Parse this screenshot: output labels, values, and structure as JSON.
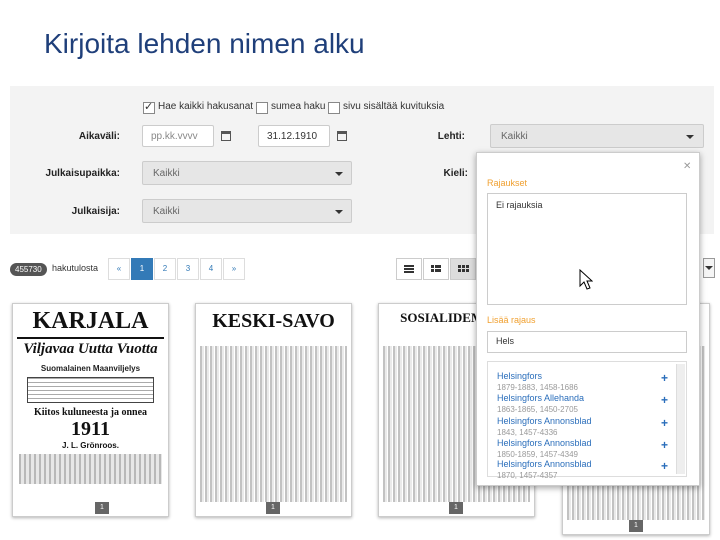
{
  "slide": {
    "title": "Kirjoita lehden nimen alku"
  },
  "filters": {
    "checkboxes": [
      {
        "label": "Hae kaikki hakusanat",
        "checked": true
      },
      {
        "label": "sumea haku",
        "checked": false
      },
      {
        "label": "sivu sisältää kuvituksia",
        "checked": false
      }
    ],
    "date_label": "Aikaväli:",
    "date_from_placeholder": "pp.kk.vvvv",
    "date_to_value": "31.12.1910",
    "lehti_label": "Lehti:",
    "lehti_value": "Kaikki",
    "julkaisupaikka_label": "Julkaisupaikka:",
    "julkaisupaikka_value": "Kaikki",
    "kieli_label": "Kieli:",
    "julkaisija_label": "Julkaisija:",
    "julkaisija_value": "Kaikki"
  },
  "results": {
    "count_badge": "455730",
    "count_label": "hakutulosta",
    "pages": [
      "«",
      "1",
      "2",
      "3",
      "4",
      "»"
    ],
    "active_page": "1"
  },
  "popup": {
    "rajaukset_title": "Rajaukset",
    "rajaukset_value": "Ei rajauksia",
    "lisaa_title": "Lisää rajaus",
    "search_value": "Hels",
    "items": [
      {
        "name": "Helsingfors",
        "years": "1879-1883, 1458-1686"
      },
      {
        "name": "Helsingfors Allehanda",
        "years": "1863-1865, 1450-2705"
      },
      {
        "name": "Helsingfors Annonsblad",
        "years": "1843, 1457-4336"
      },
      {
        "name": "Helsingfors Annonsblad",
        "years": "1850-1859, 1457-4349"
      },
      {
        "name": "Helsingfors Annonsblad",
        "years": "1870, 1457-4357"
      }
    ]
  },
  "thumbnails": [
    {
      "masthead": "KARJALA",
      "lines": [
        "Viljavaa Uutta Vuotta",
        "Suomalainen Maanviljelys",
        "Kiitos kuluneesta ja onnea",
        "1911",
        "J. L. Grönroos."
      ],
      "num": "1"
    },
    {
      "masthead": "KESKI-SAVO",
      "lines": [],
      "num": "1"
    },
    {
      "masthead": "SOSIALIDEMOKR",
      "lines": [],
      "num": "1"
    },
    {
      "masthead": "",
      "lines": [],
      "num": "1"
    }
  ]
}
